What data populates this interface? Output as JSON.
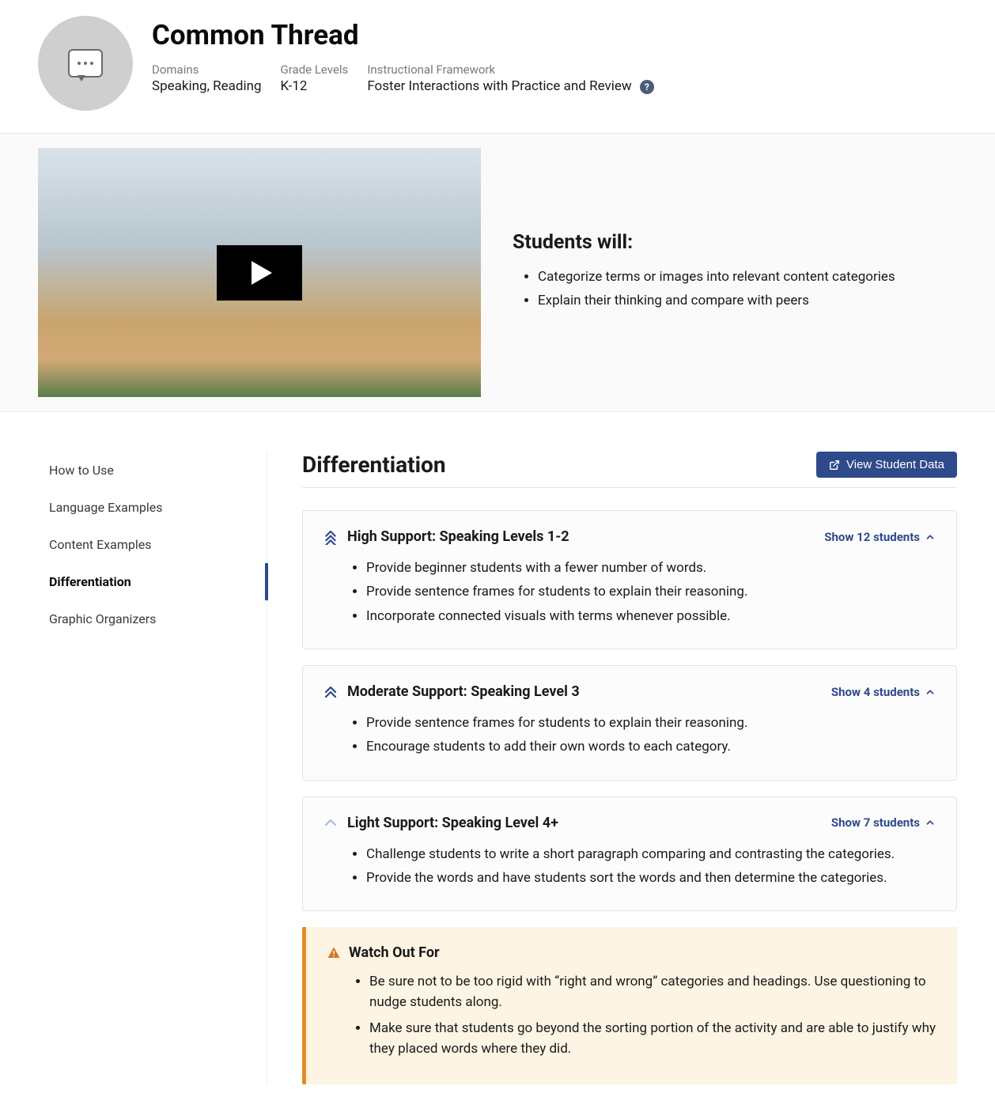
{
  "header": {
    "title": "Common Thread",
    "meta": {
      "domains_label": "Domains",
      "domains_value": "Speaking, Reading",
      "grade_label": "Grade Levels",
      "grade_value": "K-12",
      "framework_label": "Instructional Framework",
      "framework_value": "Foster Interactions with Practice and Review",
      "help_glyph": "?"
    }
  },
  "hero": {
    "students_will_heading": "Students will:",
    "objectives": [
      "Categorize terms or images into relevant content categories",
      "Explain their thinking and compare with peers"
    ]
  },
  "sidebar": {
    "items": [
      {
        "label": "How to Use",
        "active": false
      },
      {
        "label": "Language Examples",
        "active": false
      },
      {
        "label": "Content Examples",
        "active": false
      },
      {
        "label": "Differentiation",
        "active": true
      },
      {
        "label": "Graphic Organizers",
        "active": false
      }
    ]
  },
  "content": {
    "section_title": "Differentiation",
    "view_data_label": "View Student Data"
  },
  "supports": [
    {
      "level": "high",
      "title": "High Support: Speaking Levels 1-2",
      "show_label": "Show 12 students",
      "items": [
        "Provide beginner students with a fewer number of words.",
        "Provide sentence frames for students to explain their reasoning.",
        "Incorporate connected visuals with terms whenever possible."
      ]
    },
    {
      "level": "moderate",
      "title": "Moderate Support: Speaking Level 3",
      "show_label": "Show 4 students",
      "items": [
        "Provide sentence frames for students to explain their reasoning.",
        "Encourage students to add their own words to each category."
      ]
    },
    {
      "level": "light",
      "title": "Light Support: Speaking Level 4+",
      "show_label": "Show 7 students",
      "items": [
        "Challenge students to write a short paragraph comparing and contrasting the categories.",
        "Provide the words and have students sort the words and then determine the categories."
      ]
    }
  ],
  "watch_out": {
    "title": "Watch Out For",
    "items": [
      "Be sure not to be too rigid with “right and wrong” categories and headings. Use questioning to nudge students along.",
      "Make sure that students go beyond the sorting portion of the activity and are able to justify why they placed words where they did."
    ]
  }
}
